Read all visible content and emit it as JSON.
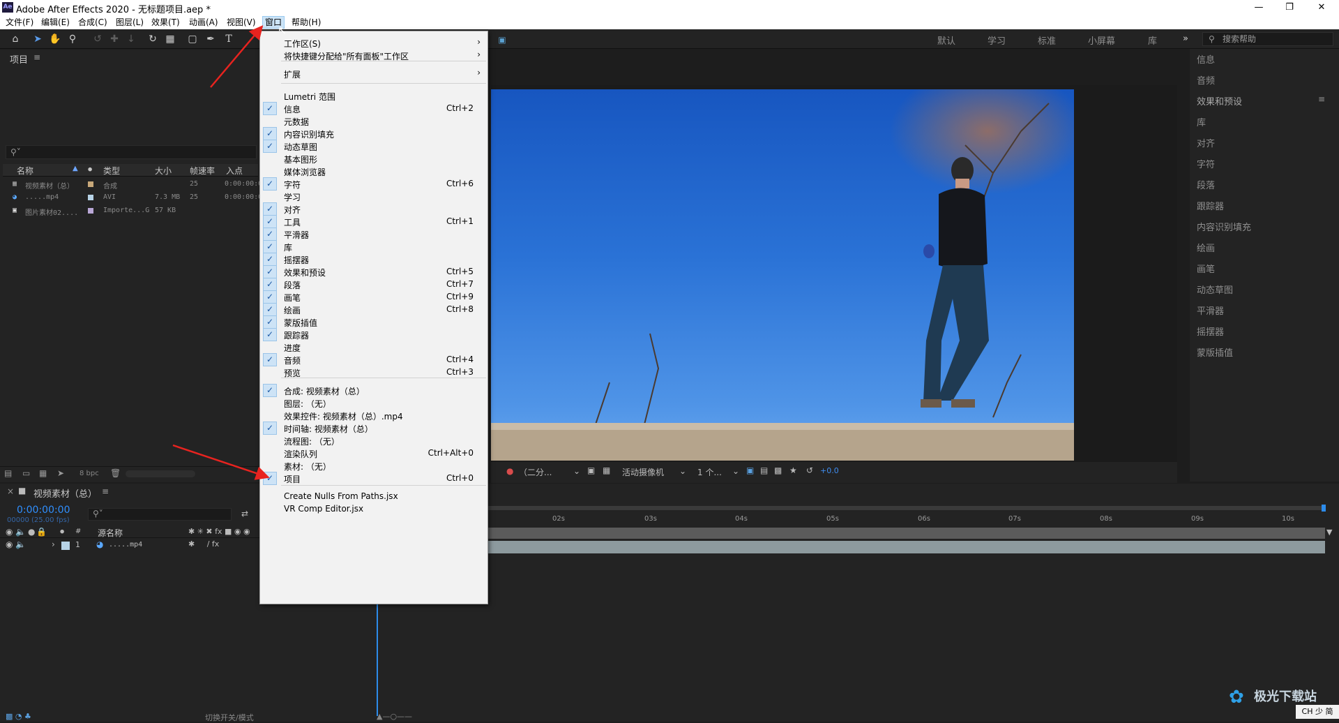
{
  "window": {
    "title": "Adobe After Effects 2020 - 无标题项目.aep *",
    "logo": "Ae"
  },
  "menubar": [
    "文件(F)",
    "编辑(E)",
    "合成(C)",
    "图层(L)",
    "效果(T)",
    "动画(A)",
    "视图(V)",
    "窗口",
    "帮助(H)"
  ],
  "workspaces": [
    "默认",
    "学习",
    "标准",
    "小屏幕",
    "库"
  ],
  "search_help": "搜索帮助",
  "project_panel": {
    "title": "项目",
    "columns": [
      "名称",
      "类型",
      "大小",
      "帧速率",
      "入点"
    ],
    "rows": [
      {
        "name": "视频素材（总）",
        "type": "合成",
        "size": "",
        "fps": "25",
        "in": "0:00:00:0"
      },
      {
        "name": ".....mp4",
        "type": "AVI",
        "size": "7.3 MB",
        "fps": "25",
        "in": "0:00:00:0"
      },
      {
        "name": "图片素材02....",
        "type": "Importe...G",
        "size": "57 KB",
        "fps": "",
        "in": ""
      }
    ],
    "bpc": "8 bpc"
  },
  "viewer": {
    "resolution": "（二分...",
    "camera": "活动摄像机",
    "views": "1 个...",
    "exposure": "+0.0"
  },
  "right_panel": [
    "信息",
    "音频",
    "效果和预设",
    "库",
    "对齐",
    "字符",
    "段落",
    "跟踪器",
    "内容识别填充",
    "绘画",
    "画笔",
    "动态草图",
    "平滑器",
    "摇摆器",
    "蒙版插值"
  ],
  "timeline": {
    "comp_name": "视频素材（总）",
    "timecode": "0:00:00:00",
    "timecode_sub": "00000 (25.00 fps)",
    "col_source": "源名称",
    "layer": {
      "num": "1",
      "name": ".....mp4"
    },
    "ruler": [
      "02s",
      "03s",
      "04s",
      "05s",
      "06s",
      "07s",
      "08s",
      "09s",
      "10s"
    ],
    "toggle_label": "切换开关/模式"
  },
  "dropdown": {
    "items": [
      {
        "label": "工作区(S)",
        "check": false,
        "shortcut": "",
        "sub": true
      },
      {
        "label": "将快捷键分配给\"所有面板\"工作区",
        "check": false,
        "shortcut": "",
        "sub": true
      },
      {
        "label": "扩展",
        "check": false,
        "shortcut": "",
        "sub": true
      },
      {
        "label": "Lumetri 范围",
        "check": false,
        "shortcut": ""
      },
      {
        "label": "信息",
        "check": true,
        "shortcut": "Ctrl+2"
      },
      {
        "label": "元数据",
        "check": false,
        "shortcut": ""
      },
      {
        "label": "内容识别填充",
        "check": true,
        "shortcut": ""
      },
      {
        "label": "动态草图",
        "check": true,
        "shortcut": ""
      },
      {
        "label": "基本图形",
        "check": false,
        "shortcut": ""
      },
      {
        "label": "媒体浏览器",
        "check": false,
        "shortcut": ""
      },
      {
        "label": "字符",
        "check": true,
        "shortcut": "Ctrl+6"
      },
      {
        "label": "学习",
        "check": false,
        "shortcut": ""
      },
      {
        "label": "对齐",
        "check": true,
        "shortcut": ""
      },
      {
        "label": "工具",
        "check": true,
        "shortcut": "Ctrl+1"
      },
      {
        "label": "平滑器",
        "check": true,
        "shortcut": ""
      },
      {
        "label": "库",
        "check": true,
        "shortcut": ""
      },
      {
        "label": "摇摆器",
        "check": true,
        "shortcut": ""
      },
      {
        "label": "效果和预设",
        "check": true,
        "shortcut": "Ctrl+5"
      },
      {
        "label": "段落",
        "check": true,
        "shortcut": "Ctrl+7"
      },
      {
        "label": "画笔",
        "check": true,
        "shortcut": "Ctrl+9"
      },
      {
        "label": "绘画",
        "check": true,
        "shortcut": "Ctrl+8"
      },
      {
        "label": "蒙版插值",
        "check": true,
        "shortcut": ""
      },
      {
        "label": "跟踪器",
        "check": true,
        "shortcut": ""
      },
      {
        "label": "进度",
        "check": false,
        "shortcut": ""
      },
      {
        "label": "音频",
        "check": true,
        "shortcut": "Ctrl+4"
      },
      {
        "label": "预览",
        "check": false,
        "shortcut": "Ctrl+3"
      },
      {
        "label": "合成: 视频素材（总）",
        "check": true,
        "shortcut": ""
      },
      {
        "label": "图层: （无）",
        "check": false,
        "shortcut": ""
      },
      {
        "label": "效果控件: 视频素材（总）.mp4",
        "check": false,
        "shortcut": ""
      },
      {
        "label": "时间轴: 视频素材（总）",
        "check": true,
        "shortcut": ""
      },
      {
        "label": "流程图: （无）",
        "check": false,
        "shortcut": ""
      },
      {
        "label": "渲染队列",
        "check": false,
        "shortcut": "Ctrl+Alt+0"
      },
      {
        "label": "素材: （无）",
        "check": false,
        "shortcut": ""
      },
      {
        "label": "项目",
        "check": true,
        "shortcut": "Ctrl+0"
      },
      {
        "label": "Create Nulls From Paths.jsx",
        "check": false,
        "shortcut": ""
      },
      {
        "label": "VR Comp Editor.jsx",
        "check": false,
        "shortcut": ""
      }
    ]
  },
  "watermark": "极光下载站",
  "ime": "CH 少 简",
  "colors": {
    "accent": "#2d8ceb",
    "arrow": "#e8231f",
    "timecode": "#2f8fff"
  }
}
